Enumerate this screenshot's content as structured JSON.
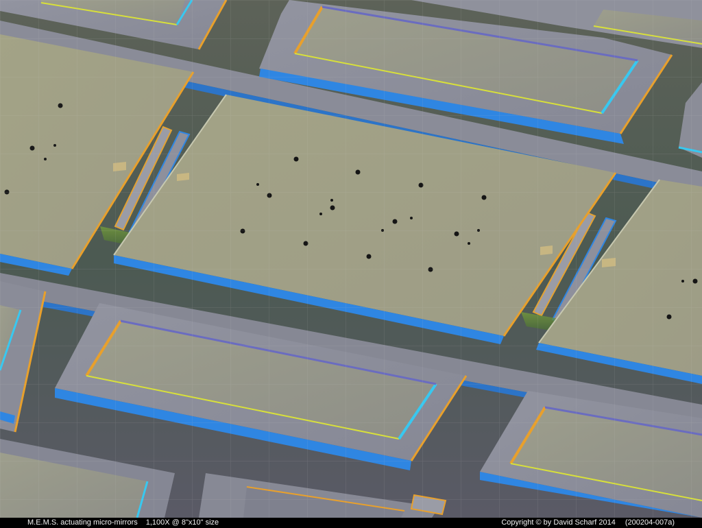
{
  "caption": {
    "subject": "M.E.M.S. actuating micro-mirrors",
    "magnification": "1,100X @ 8\"x10\" size",
    "copyright": "Copyright © by David Scharf 2014",
    "image_code": "(200204-007a)"
  },
  "palette": {
    "substrate": "#4e5c52",
    "gap_shadow": "#1c2a2c",
    "frame_top": "#8d8f99",
    "mirror_plate": "#a7a687",
    "edge_blue": "#2f86e2",
    "edge_orange": "#e8a02c",
    "edge_yellow": "#d8e03a",
    "edge_cyan": "#38c8f0",
    "grid_line": "#c8c8c8"
  }
}
